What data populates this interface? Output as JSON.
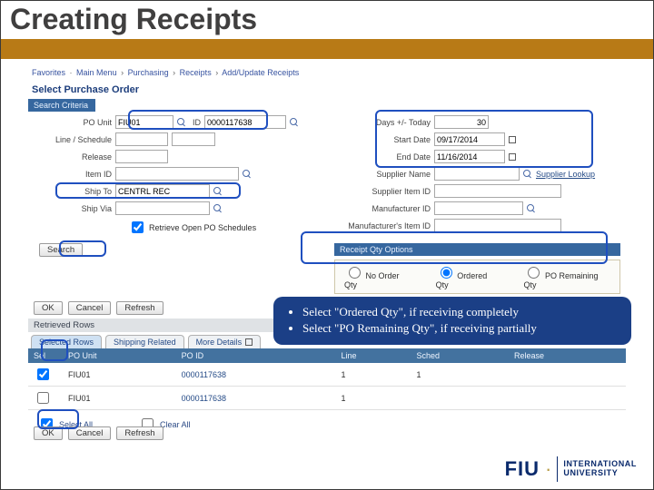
{
  "slide": {
    "title": "Creating Receipts"
  },
  "logo": {
    "fiu": "FIU",
    "line1": "INTERNATIONAL",
    "line2": "UNIVERSITY"
  },
  "breadcrumb": {
    "favorites": "Favorites",
    "mainmenu": "Main Menu",
    "purchasing": "Purchasing",
    "receipts": "Receipts",
    "addupdate": "Add/Update Receipts"
  },
  "page": {
    "heading": "Select Purchase Order",
    "searchCriteria": "Search Criteria",
    "retrievedRows": "Retrieved Rows",
    "receiptQtyOptions": "Receipt Qty Options"
  },
  "labels": {
    "poUnit": "PO Unit",
    "id": "ID",
    "lineSched": "Line / Schedule",
    "release": "Release",
    "itemId": "Item ID",
    "shipTo": "Ship To",
    "shipVia": "Ship Via",
    "retrieveOpen": "Retrieve Open PO Schedules",
    "daysToday": "Days +/- Today",
    "startDate": "Start Date",
    "endDate": "End Date",
    "supplierName": "Supplier Name",
    "supplierItemId": "Supplier Item ID",
    "mfgId": "Manufacturer ID",
    "mfgItemId": "Manufacturer's Item ID",
    "supplierLookup": "Supplier Lookup"
  },
  "values": {
    "poUnit": "FIU01",
    "poId": "0000117638",
    "shipTo": "CENTRL REC",
    "days": "30",
    "startDate": "09/17/2014",
    "endDate": "11/16/2014"
  },
  "buttons": {
    "search": "Search",
    "ok": "OK",
    "cancel": "Cancel",
    "refresh": "Refresh"
  },
  "qty": {
    "noOrder": "No Order Qty",
    "ordered": "Ordered Qty",
    "remaining": "PO Remaining Qty"
  },
  "tabs": {
    "selected": "Selected Rows",
    "shipping": "Shipping Related",
    "more": "More Details"
  },
  "cols": {
    "sel": "Sel",
    "poUnit": "PO Unit",
    "poId": "PO ID",
    "line": "Line",
    "sched": "Sched",
    "release": "Release"
  },
  "rows": [
    {
      "sel": true,
      "poUnit": "FIU01",
      "poId": "0000117638",
      "line": "1",
      "sched": "1",
      "release": ""
    },
    {
      "sel": false,
      "poUnit": "FIU01",
      "poId": "0000117638",
      "line": "1",
      "sched": "",
      "release": ""
    }
  ],
  "selectall": {
    "selectAll": "Select All",
    "clearAll": "Clear All"
  },
  "callout": {
    "b1": "Select \"Ordered Qty\", if receiving completely",
    "b2": "Select \"PO Remaining Qty\", if receiving partially"
  }
}
